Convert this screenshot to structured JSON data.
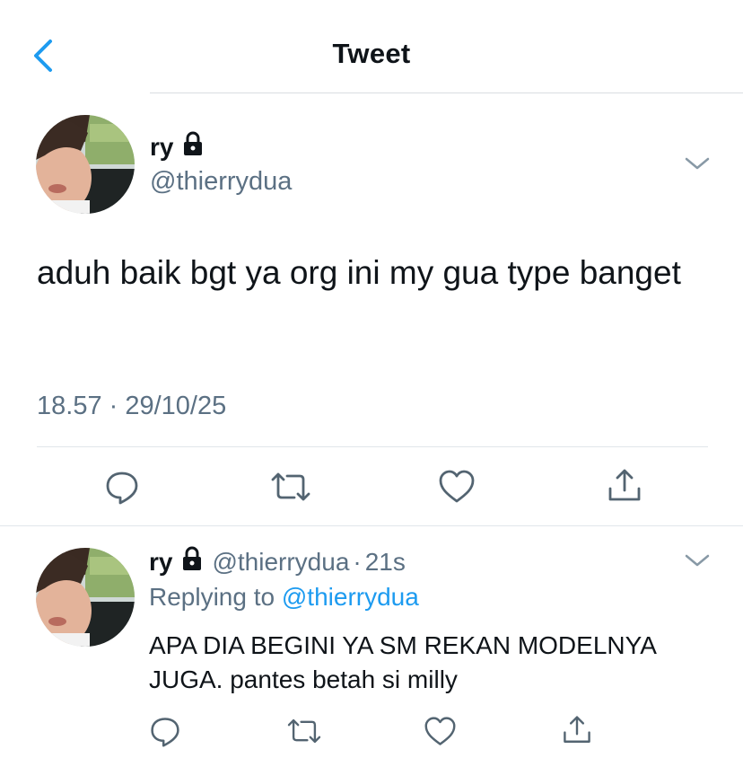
{
  "header": {
    "title": "Tweet",
    "back_icon": "chevron-left-icon"
  },
  "tweet": {
    "author_name": "ry",
    "author_handle": "@thierrydua",
    "locked_icon": "lock-icon",
    "text": "aduh baik bgt ya org ini my gua type banget",
    "timestamp": "18.57 · 29/10/25",
    "actions": {
      "reply_icon": "reply-icon",
      "retweet_icon": "retweet-icon",
      "like_icon": "heart-icon",
      "share_icon": "share-icon"
    }
  },
  "reply": {
    "author_name": "ry",
    "author_handle": "@thierrydua",
    "separator": "·",
    "time": "21s",
    "replying_prefix": "Replying to",
    "replying_to": "@thierrydua",
    "text": "APA DIA BEGINI YA SM REKAN MODELNYA JUGA. pantes betah si milly"
  },
  "colors": {
    "accent": "#1d9bf0",
    "secondary_text": "#5b7083",
    "primary_text": "#0f1419",
    "icon_gray": "#536471",
    "divider": "#e1e6ea"
  }
}
